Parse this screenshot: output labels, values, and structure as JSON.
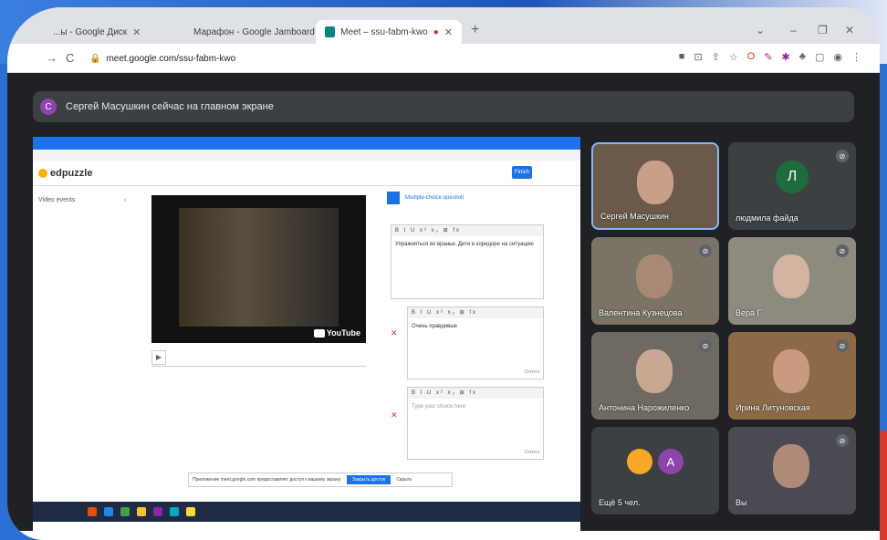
{
  "tabs": [
    {
      "title": "...ы - Google Диск",
      "icon_color": "#4285f4"
    },
    {
      "title": "Марафон - Google Jamboard",
      "icon_color": "#fbbc04"
    },
    {
      "title": "Meet – ssu-fabm-kwo",
      "icon_color": "#00897b"
    }
  ],
  "address": {
    "url": "meet.google.com/ssu-fabm-kwo"
  },
  "banner": {
    "avatar_letter": "С",
    "text": "Сергей Масушкин сейчас на главном экране"
  },
  "shared": {
    "logo": "edpuzzle",
    "side_label": "Video events",
    "finish_label": "Finish",
    "question_type": "Multiple-choice question",
    "toolbar": "B I U x² x₂ ⊞ fx",
    "answer_main": "Упражняться во вранье. Дети в коридоре на ситуацию",
    "answer_1": "Очень правдивые",
    "answer_2": "Type your choice here",
    "correct": "Correct",
    "youtube": "YouTube",
    "notify_text": "Приложение meet.google.com предоставляет доступ к вашему экрану.",
    "notify_button": "Закрыть доступ",
    "notify_hide": "Скрыть"
  },
  "participants": [
    {
      "name": "Сергей Масушкин",
      "kind": "video"
    },
    {
      "name": "людмила файда",
      "kind": "initial",
      "letter": "Л",
      "color": "#1e6b3b"
    },
    {
      "name": "Валентина Кузнецова",
      "kind": "video"
    },
    {
      "name": "Вера Г",
      "kind": "video"
    },
    {
      "name": "Антонина Нарожиленко",
      "kind": "video"
    },
    {
      "name": "Ирина Литуновская",
      "kind": "video"
    },
    {
      "name": "Ещё 5 чел.",
      "kind": "more",
      "letter": "А",
      "color": "#8e44ad"
    },
    {
      "name": "Вы",
      "kind": "video"
    }
  ]
}
